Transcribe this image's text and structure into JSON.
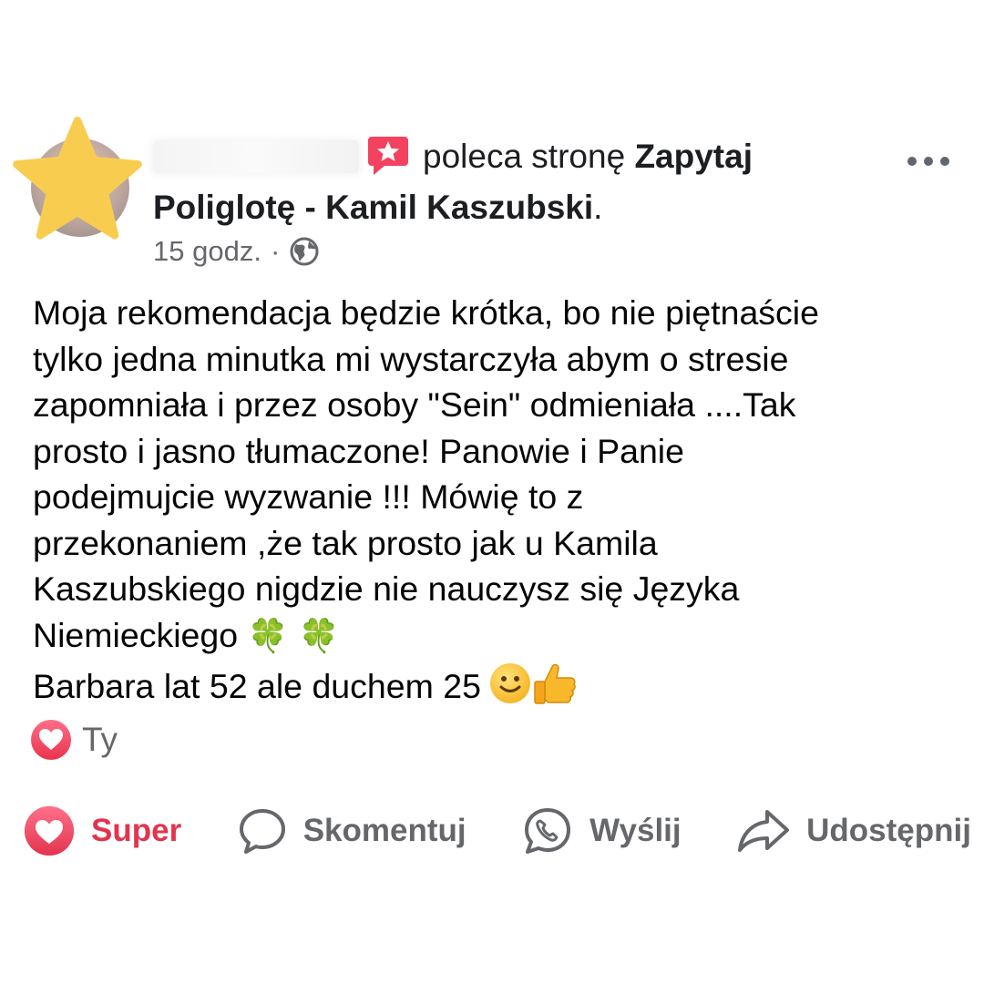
{
  "post": {
    "recommend_text": "poleca stronę",
    "page_name": "Zapytaj Poliglotę - Kamil Kaszubski",
    "period": ".",
    "time": "15 godz.",
    "separator": "·",
    "body": "Moja rekomendacja będzie krótka, bo nie piętnaście\ntylko jedna minutka mi wystarczyła abym o stresie\nzapomniała i przez osoby \"Sein\" odmieniała ....Tak\nprosto i jasno tłumaczone! Panowie i Panie\npodejmujcie wyzwanie !!! Mówię to z\nprzekonaniem ,że tak prosto jak u Kamila\nKaszubskiego nigdzie nie nauczysz się Języka\nNiemieckiego ",
    "clover_emoji": "🍀 🍀",
    "signature": "Barbara lat 52 ale duchem 25"
  },
  "reactions": {
    "who": "Ty"
  },
  "actions": {
    "super": "Super",
    "comment": "Skomentuj",
    "send": "Wyślij",
    "share": "Udostępnij"
  },
  "colors": {
    "super_red": "#e3344e",
    "star_yellow": "#f8cd4f",
    "recommend_red": "#f3425f",
    "muted": "#65676b"
  },
  "icons": [
    "star-icon",
    "recommend-icon",
    "globe-icon",
    "more-icon",
    "heart-icon",
    "comment-icon",
    "messenger-icon",
    "share-icon",
    "smile-emoji",
    "thumbs-up-emoji"
  ]
}
